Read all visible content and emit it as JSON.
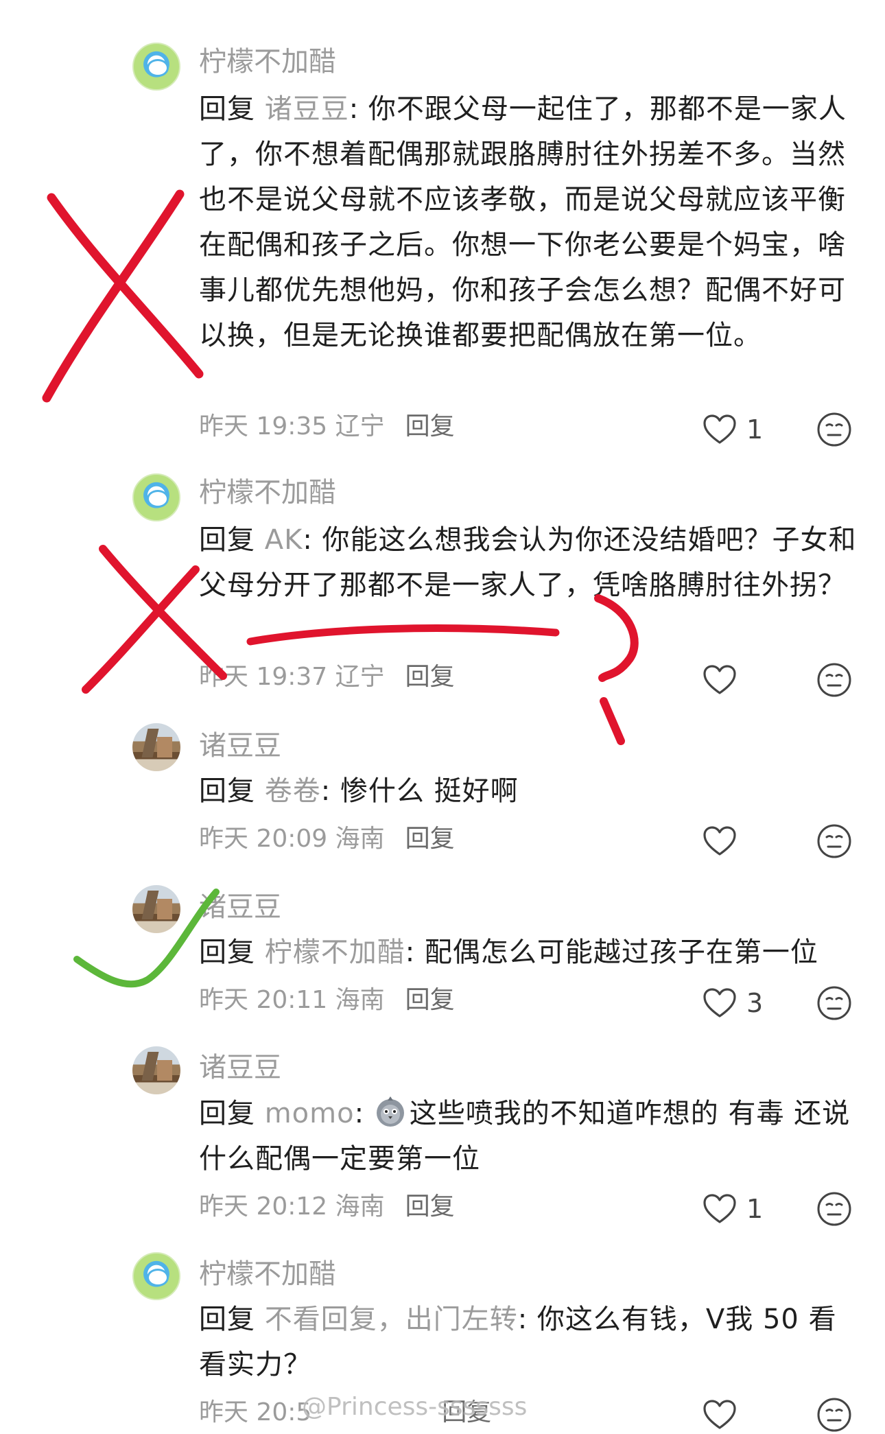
{
  "comments": [
    {
      "user": "柠檬不加醋",
      "reply_word": "回复",
      "reply_to": "诸豆豆",
      "text": ": 你不跟父母一起住了，那都不是一家人了，你不想着配偶那就跟胳膊肘往外拐差不多。当然也不是说父母就不应该孝敬，而是说父母就应该平衡在配偶和孩子之后。你想一下你老公要是个妈宝，啥事儿都优先想他妈，你和孩子会怎么想？配偶不好可以换，但是无论换谁都要把配偶放在第一位。",
      "time": "昨天 19:35 辽宁",
      "reply_label": "回复",
      "likes": "1"
    },
    {
      "user": "柠檬不加醋",
      "reply_word": "回复",
      "reply_to": "AK",
      "text": ": 你能这么想我会认为你还没结婚吧？子女和父母分开了那都不是一家人了，凭啥胳膊肘往外拐？",
      "time": "昨天 19:37 辽宁",
      "reply_label": "回复",
      "likes": ""
    },
    {
      "user": "诸豆豆",
      "reply_word": "回复",
      "reply_to": "卷卷",
      "text": ": 惨什么 挺好啊",
      "time": "昨天 20:09 海南",
      "reply_label": "回复",
      "likes": ""
    },
    {
      "user": "诸豆豆",
      "reply_word": "回复",
      "reply_to": "柠檬不加醋",
      "text": ": 配偶怎么可能越过孩子在第一位",
      "time": "昨天 20:11 海南",
      "reply_label": "回复",
      "likes": "3"
    },
    {
      "user": "诸豆豆",
      "reply_word": "回复",
      "reply_to": "momo",
      "text_before_emoji": ": ",
      "text": "这些喷我的不知道咋想的 有毒 还说什么配偶一定要第一位",
      "time": "昨天 20:12 海南",
      "reply_label": "回复",
      "likes": "1"
    },
    {
      "user": "柠檬不加醋",
      "reply_word": "回复",
      "reply_to": "不看回复，出门左转",
      "text": ": 你这么有钱，V我 50 看看实力？",
      "time": "昨天 20:5",
      "reply_label": "回复",
      "likes": ""
    }
  ],
  "watermark": "@Princess-sssssss",
  "icons": {
    "like": "heart-outline-icon",
    "reaction": "neutral-face-icon"
  },
  "colors": {
    "annotation_red": "#e0142d",
    "annotation_green": "#5cb73a",
    "muted": "#9b9b9b"
  }
}
